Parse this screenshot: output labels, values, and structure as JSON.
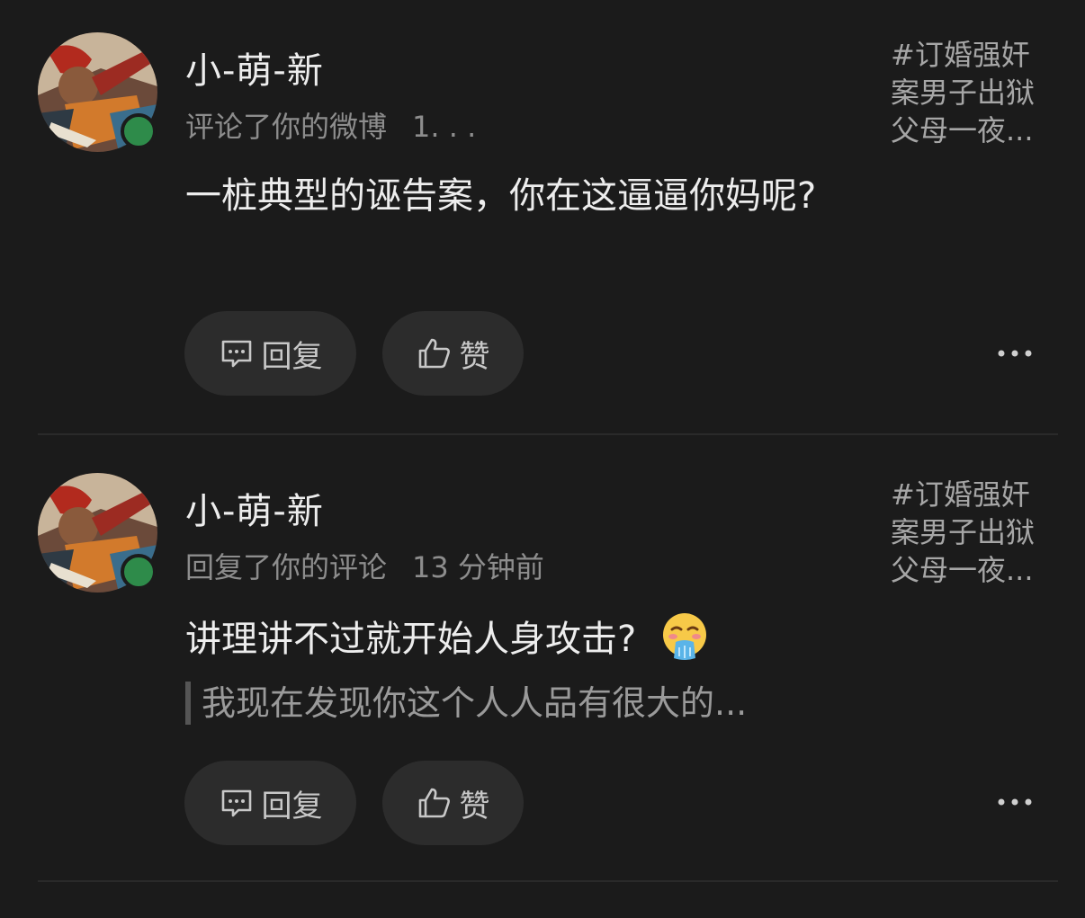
{
  "notifications": [
    {
      "username": "小-萌-新",
      "action": "评论了你的微博",
      "time": "1. . .",
      "topic_lines": [
        "#订婚强奸",
        "案男子出狱",
        "父母一夜..."
      ],
      "content": "一桩典型的诬告案，你在这逼逼你妈呢?",
      "reply_label": "回复",
      "like_label": "赞"
    },
    {
      "username": "小-萌-新",
      "action": "回复了你的评论",
      "time": "13 分钟前",
      "topic_lines": [
        "#订婚强奸",
        "案男子出狱",
        "父母一夜..."
      ],
      "content": "讲理讲不过就开始人身攻击?",
      "emoji": "vomiting-face-emoji",
      "quote": "我现在发现你这个人人品有很大的...",
      "reply_label": "回复",
      "like_label": "赞"
    }
  ],
  "colors": {
    "background": "#1b1b1b",
    "button_bg": "#2c2c2c",
    "online": "#2e8b4a"
  }
}
